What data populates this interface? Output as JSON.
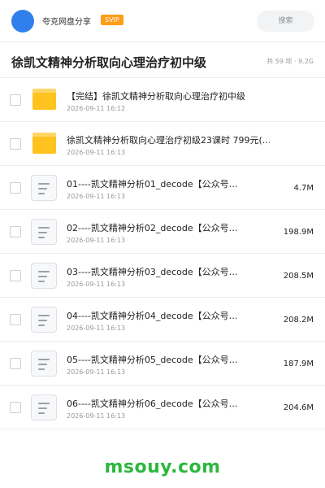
{
  "header": {
    "app_name": "夸克网盘分享",
    "badge": "SVIP",
    "search_placeholder": "搜索"
  },
  "share": {
    "title": "徐凯文精神分析取向心理治疗初中级",
    "summary": "共 59 项 · 9.2G"
  },
  "files": [
    {
      "type": "folder",
      "name": "【完结】徐凯文精神分析取向心理治疗初中级",
      "date": "2026-09-11 16:12",
      "size": ""
    },
    {
      "type": "folder",
      "name": "徐凯文精神分析取向心理治疗初级23课时 799元(…",
      "date": "2026-09-11 16:13",
      "size": ""
    },
    {
      "type": "file",
      "name": "01----凯文精神分析01_decode【公众号…",
      "date": "2026-09-11 16:13",
      "size": "4.7M"
    },
    {
      "type": "file",
      "name": "02----凯文精神分析02_decode【公众号…",
      "date": "2026-09-11 16:13",
      "size": "198.9M"
    },
    {
      "type": "file",
      "name": "03----凯文精神分析03_decode【公众号…",
      "date": "2026-09-11 16:13",
      "size": "208.5M"
    },
    {
      "type": "file",
      "name": "04----凯文精神分析04_decode【公众号…",
      "date": "2026-09-11 16:13",
      "size": "208.2M"
    },
    {
      "type": "file",
      "name": "05----凯文精神分析05_decode【公众号…",
      "date": "2026-09-11 16:13",
      "size": "187.9M"
    },
    {
      "type": "file",
      "name": "06----凯文精神分析06_decode【公众号…",
      "date": "2026-09-11 16:13",
      "size": "204.6M"
    }
  ],
  "watermark": "msouy.com",
  "colors": {
    "avatar": "#2f80ed",
    "badge": "#ff9c1a",
    "folder": "#ffc31f",
    "watermark": "#2db83d"
  }
}
